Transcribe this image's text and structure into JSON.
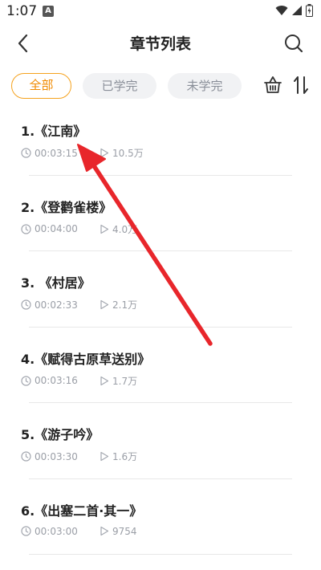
{
  "status_bar": {
    "time": "1:07",
    "app_icon_letter": "A"
  },
  "header": {
    "title": "章节列表"
  },
  "tabs": [
    {
      "label": "全部",
      "active": true
    },
    {
      "label": "已学完",
      "active": false
    },
    {
      "label": "未学完",
      "active": false
    }
  ],
  "chapters": [
    {
      "title": "1.《江南》",
      "duration": "00:03:15",
      "plays": "10.5万"
    },
    {
      "title": "2.《登鹳雀楼》",
      "duration": "00:04:00",
      "plays": "4.0万"
    },
    {
      "title": "3. 《村居》",
      "duration": "00:02:33",
      "plays": "2.1万"
    },
    {
      "title": "4.《赋得古原草送别》",
      "duration": "00:03:16",
      "plays": "1.7万"
    },
    {
      "title": "5.《游子吟》",
      "duration": "00:03:30",
      "plays": "1.6万"
    },
    {
      "title": "6.《出塞二首·其一》",
      "duration": "00:03:00",
      "plays": "9754"
    }
  ],
  "colors": {
    "accent": "#f5a21d",
    "annotation_arrow": "#e8262b"
  },
  "icons": {
    "back": "chevron-left-icon",
    "search": "search-icon",
    "basket": "basket-icon",
    "sort": "sort-icon",
    "duration": "clock-icon",
    "plays": "play-icon"
  }
}
